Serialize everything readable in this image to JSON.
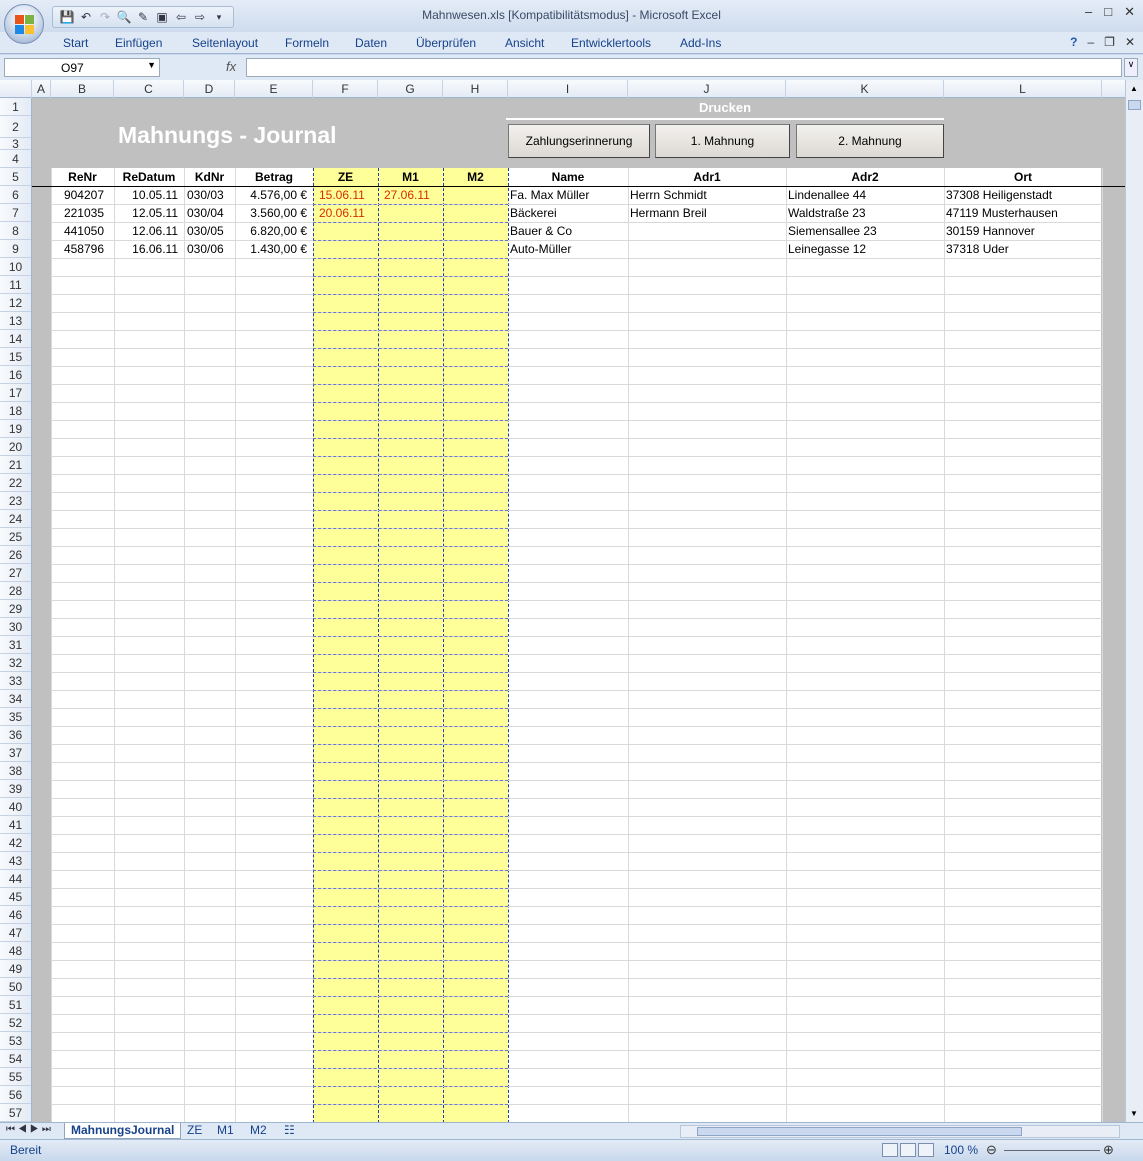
{
  "window": {
    "title": "Mahnwesen.xls  [Kompatibilitätsmodus] - Microsoft Excel"
  },
  "ribbon": {
    "tabs": [
      "Start",
      "Einfügen",
      "Seitenlayout",
      "Formeln",
      "Daten",
      "Überprüfen",
      "Ansicht",
      "Entwicklertools",
      "Add-Ins"
    ]
  },
  "formula_bar": {
    "name_box": "O97",
    "fx": "fx",
    "formula": ""
  },
  "columns": [
    "A",
    "B",
    "C",
    "D",
    "E",
    "F",
    "G",
    "H",
    "I",
    "J",
    "K",
    "L"
  ],
  "sheet": {
    "title": "Mahnungs - Journal",
    "print_label": "Drucken",
    "buttons": [
      "Zahlungserinnerung",
      "1. Mahnung",
      "2. Mahnung"
    ],
    "headers": [
      "ReNr",
      "ReDatum",
      "KdNr",
      "Betrag",
      "ZE",
      "M1",
      "M2",
      "Name",
      "Adr1",
      "Adr2",
      "Ort"
    ],
    "rows": [
      {
        "renr": "904207",
        "redatum": "10.05.11",
        "kdnr": "030/03",
        "betrag": "4.576,00 €",
        "ze": "15.06.11",
        "m1": "27.06.11",
        "m2": "",
        "name": "Fa. Max Müller",
        "adr1": "Herrn Schmidt",
        "adr2": "Lindenallee 44",
        "ort": "37308 Heiligenstadt"
      },
      {
        "renr": "221035",
        "redatum": "12.05.11",
        "kdnr": "030/04",
        "betrag": "3.560,00 €",
        "ze": "20.06.11",
        "m1": "",
        "m2": "",
        "name": "Bäckerei",
        "adr1": "Hermann Breil",
        "adr2": "Waldstraße 23",
        "ort": "47119 Musterhausen"
      },
      {
        "renr": "441050",
        "redatum": "12.06.11",
        "kdnr": "030/05",
        "betrag": "6.820,00 €",
        "ze": "",
        "m1": "",
        "m2": "",
        "name": "Bauer & Co",
        "adr1": "",
        "adr2": "Siemensallee 23",
        "ort": "30159 Hannover"
      },
      {
        "renr": "458796",
        "redatum": "16.06.11",
        "kdnr": "030/06",
        "betrag": "1.430,00 €",
        "ze": "",
        "m1": "",
        "m2": "",
        "name": "Auto-Müller",
        "adr1": "",
        "adr2": "Leinegasse 12",
        "ort": "37318 Uder"
      }
    ]
  },
  "sheet_tabs": [
    "MahnungsJournal",
    "ZE",
    "M1",
    "M2"
  ],
  "active_sheet": "MahnungsJournal",
  "status": {
    "ready": "Bereit",
    "zoom": "100 %"
  },
  "colors": {
    "highlight_column": "#ffff99",
    "reminder_date": "#d62e00",
    "frame_gray": "#c0c0c0"
  }
}
